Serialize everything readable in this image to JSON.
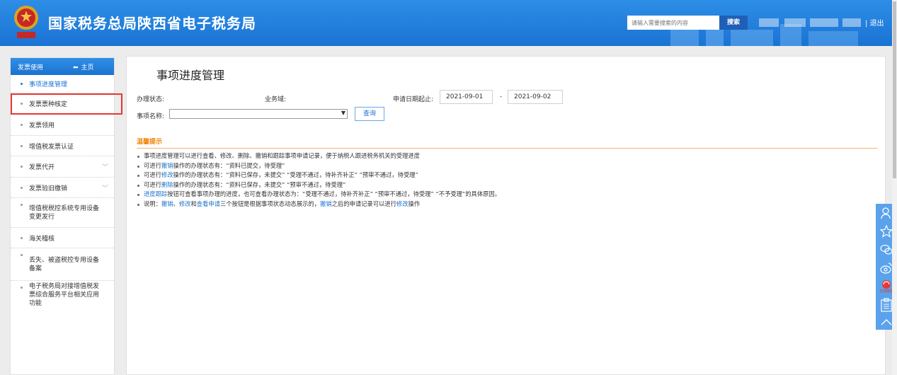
{
  "header": {
    "title": "国家税务总局陕西省电子税务局",
    "search_placeholder": "请输入需要搜索的内容",
    "search_button": "搜索",
    "logout": "退出"
  },
  "sidebar": {
    "title": "发票使用",
    "home": "主页",
    "items": [
      {
        "label": "事项进度管理",
        "active": true
      },
      {
        "label": "发票票种核定",
        "highlighted": true
      },
      {
        "label": "发票领用"
      },
      {
        "label": "增值税发票认证"
      },
      {
        "label": "发票代开",
        "expandable": true
      },
      {
        "label": "发票验旧缴销",
        "expandable": true
      },
      {
        "label": "增值税税控系统专用设备变更发行"
      },
      {
        "label": "海关稽核"
      },
      {
        "label": "丢失、被盗税控专用设备备案"
      },
      {
        "label": "电子税务局对接增值税发票综合服务平台相关应用功能"
      }
    ]
  },
  "main": {
    "title": "事项进度管理",
    "status_label": "办理状态:",
    "domain_label": "业务域:",
    "date_range_label": "申请日期起止:",
    "date_from": "2021-09-01",
    "date_sep": "-",
    "date_to": "2021-09-02",
    "item_name_label": "事项名称:",
    "item_name_value": "",
    "query_button": "查询",
    "tips_heading": "温馨提示",
    "tips": {
      "t1": "事项进度管理可以进行查看、修改、删除、撤销和跟踪事项申请记录，便于纳税人跟进税务机关的受理进度",
      "t2a": "可进行",
      "t2b": "撤销",
      "t2c": "操作的办理状态有：“资料已提交，待受理”",
      "t3a": "可进行",
      "t3b": "修改",
      "t3c": "操作的办理状态有：“资料已保存，未提交”  “受理不通过，待补齐补正”  “预审不通过，待受理”",
      "t4a": "可进行",
      "t4b": "删除",
      "t4c": "操作的办理状态有：“资料已保存，未提交”  “预审不通过，待受理”",
      "t5a": "进度跟踪",
      "t5b": "按钮可查看事项办理的进度，也可查看办理状态为：“受理不通过，待补齐补正”  “预审不通过，待受理”  “不予受理”的具体原因。",
      "t6a": "说明：",
      "t6b": "撤销",
      "t6c": "、",
      "t6d": "修改",
      "t6e": "和",
      "t6f": "查看申请",
      "t6g": "三个按钮是根据事项状态动态展示的，",
      "t6h": "撤销",
      "t6i": "之后的申请记录可以进行",
      "t6j": "修改",
      "t6k": "操作"
    }
  },
  "float_bar": {
    "icons": [
      "user-icon",
      "star-icon",
      "wechat-icon",
      "weibo-icon",
      "online-service-icon",
      "clipboard-icon",
      "back-to-top-icon"
    ],
    "service_label": "在线客服"
  },
  "colors": {
    "header_blue": "#1a73d4",
    "accent_orange": "#f08200",
    "link_blue": "#1b72d0",
    "highlight_red": "#e53935"
  }
}
